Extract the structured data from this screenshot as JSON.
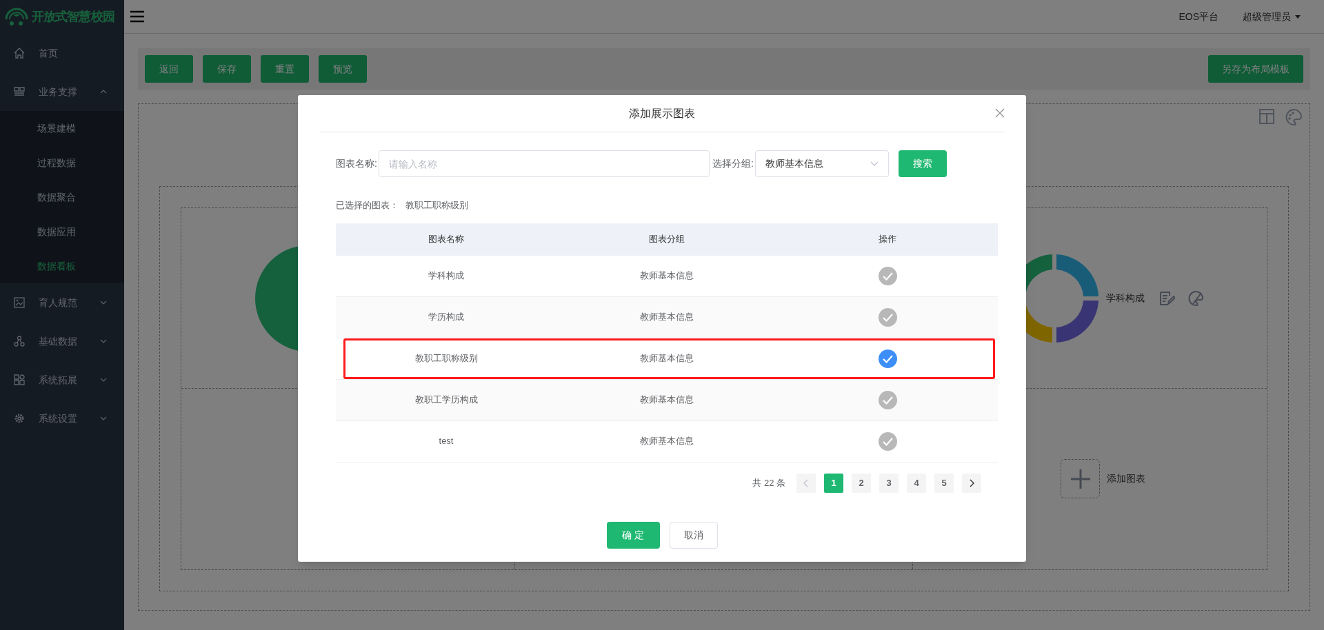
{
  "logo": {
    "text": "开放式智慧校园"
  },
  "sidebar": {
    "items": [
      {
        "label": "首页",
        "selected": false
      },
      {
        "label": "业务支撑",
        "selected": false,
        "expanded": true,
        "children": [
          {
            "label": "场景建模",
            "selected": false
          },
          {
            "label": "过程数据",
            "selected": false
          },
          {
            "label": "数据聚合",
            "selected": false
          },
          {
            "label": "数据应用",
            "selected": false
          },
          {
            "label": "数据看板",
            "selected": true
          }
        ]
      },
      {
        "label": "育人规范",
        "selected": false,
        "expanded": false
      },
      {
        "label": "基础数据",
        "selected": false,
        "expanded": false
      },
      {
        "label": "系统拓展",
        "selected": false,
        "expanded": false
      },
      {
        "label": "系统设置",
        "selected": false,
        "expanded": false
      }
    ]
  },
  "header": {
    "platform": "EOS平台",
    "user": "超级管理员"
  },
  "toolbar": {
    "buttons": [
      "返回",
      "保存",
      "重置",
      "预览"
    ],
    "save_template": "另存为布局模板"
  },
  "canvas": {
    "chart_label": "学科构成",
    "add_chart": "添加图表"
  },
  "dialog": {
    "title": "添加展示图表",
    "name_label": "图表名称:",
    "name_placeholder": "请输入名称",
    "group_label": "选择分组:",
    "group_value": "教师基本信息",
    "search_button": "搜索",
    "selected_label": "已选择的图表：",
    "selected_value": "教职工职称级别",
    "table": {
      "columns": [
        "图表名称",
        "图表分组",
        "操作"
      ],
      "rows": [
        {
          "name": "学科构成",
          "group": "教师基本信息",
          "selected": false,
          "highlighted": false
        },
        {
          "name": "学历构成",
          "group": "教师基本信息",
          "selected": false,
          "highlighted": false
        },
        {
          "name": "教职工职称级别",
          "group": "教师基本信息",
          "selected": true,
          "highlighted": true
        },
        {
          "name": "教职工学历构成",
          "group": "教师基本信息",
          "selected": false,
          "highlighted": false
        },
        {
          "name": "test",
          "group": "教师基本信息",
          "selected": false,
          "highlighted": false
        }
      ]
    },
    "pagination": {
      "total": "共 22 条",
      "prev": {
        "disabled": true
      },
      "next": {
        "disabled": false
      },
      "pages": [
        {
          "label": "1",
          "selected": true
        },
        {
          "label": "2",
          "selected": false
        },
        {
          "label": "3",
          "selected": false
        },
        {
          "label": "4",
          "selected": false
        },
        {
          "label": "5",
          "selected": false
        }
      ]
    },
    "confirm": "确 定",
    "cancel": "取消"
  }
}
